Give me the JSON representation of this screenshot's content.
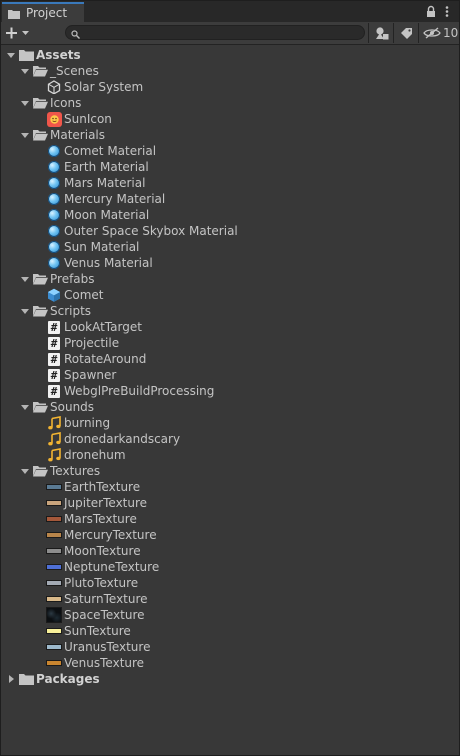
{
  "window": {
    "tab_title": "Project",
    "hidden_count": "10",
    "search": {
      "placeholder": "",
      "value": ""
    }
  },
  "icons": {
    "tab": "folder-tab-icon",
    "lock": "lock-icon",
    "menu": "kebab-menu-icon",
    "create": "plus-dropdown-icon",
    "search": "search-icon",
    "type_filter": "type-filter-icon",
    "label_filter": "label-tag-icon",
    "hidden": "eye-hidden-icon"
  },
  "tree": [
    {
      "label": "Assets",
      "depth": 0,
      "kind": "root",
      "expanded": true,
      "bold": true
    },
    {
      "label": "_Scenes",
      "depth": 1,
      "kind": "folder",
      "expanded": true
    },
    {
      "label": "Solar System",
      "depth": 2,
      "kind": "scene"
    },
    {
      "label": "Icons",
      "depth": 1,
      "kind": "folder",
      "expanded": true
    },
    {
      "label": "SunIcon",
      "depth": 2,
      "kind": "sunicon"
    },
    {
      "label": "Materials",
      "depth": 1,
      "kind": "folder",
      "expanded": true
    },
    {
      "label": "Comet Material",
      "depth": 2,
      "kind": "material"
    },
    {
      "label": "Earth Material",
      "depth": 2,
      "kind": "material"
    },
    {
      "label": "Mars Material",
      "depth": 2,
      "kind": "material"
    },
    {
      "label": "Mercury Material",
      "depth": 2,
      "kind": "material"
    },
    {
      "label": "Moon Material",
      "depth": 2,
      "kind": "material"
    },
    {
      "label": "Outer Space Skybox Material",
      "depth": 2,
      "kind": "material"
    },
    {
      "label": "Sun Material",
      "depth": 2,
      "kind": "material"
    },
    {
      "label": "Venus Material",
      "depth": 2,
      "kind": "material"
    },
    {
      "label": "Prefabs",
      "depth": 1,
      "kind": "folder",
      "expanded": true
    },
    {
      "label": "Comet",
      "depth": 2,
      "kind": "prefab"
    },
    {
      "label": "Scripts",
      "depth": 1,
      "kind": "folder",
      "expanded": true
    },
    {
      "label": "LookAtTarget",
      "depth": 2,
      "kind": "script"
    },
    {
      "label": "Projectile",
      "depth": 2,
      "kind": "script"
    },
    {
      "label": "RotateAround",
      "depth": 2,
      "kind": "script"
    },
    {
      "label": "Spawner",
      "depth": 2,
      "kind": "script"
    },
    {
      "label": "WebglPreBuildProcessing",
      "depth": 2,
      "kind": "script"
    },
    {
      "label": "Sounds",
      "depth": 1,
      "kind": "folder",
      "expanded": true
    },
    {
      "label": "burning",
      "depth": 2,
      "kind": "audio"
    },
    {
      "label": "dronedarkandscary",
      "depth": 2,
      "kind": "audio"
    },
    {
      "label": "dronehum",
      "depth": 2,
      "kind": "audio"
    },
    {
      "label": "Textures",
      "depth": 1,
      "kind": "folder",
      "expanded": true
    },
    {
      "label": "EarthTexture",
      "depth": 2,
      "kind": "texture",
      "color": "#5a7a93"
    },
    {
      "label": "JupiterTexture",
      "depth": 2,
      "kind": "texture",
      "color": "#c9a47c"
    },
    {
      "label": "MarsTexture",
      "depth": 2,
      "kind": "texture",
      "color": "#a4583a"
    },
    {
      "label": "MercuryTexture",
      "depth": 2,
      "kind": "texture",
      "color": "#b8854a"
    },
    {
      "label": "MoonTexture",
      "depth": 2,
      "kind": "texture",
      "color": "#8d8d8d"
    },
    {
      "label": "NeptuneTexture",
      "depth": 2,
      "kind": "texture",
      "color": "#4e6fd6"
    },
    {
      "label": "PlutoTexture",
      "depth": 2,
      "kind": "texture",
      "color": "#a3aab4"
    },
    {
      "label": "SaturnTexture",
      "depth": 2,
      "kind": "texture",
      "color": "#d9b98a"
    },
    {
      "label": "SpaceTexture",
      "depth": 2,
      "kind": "texture-space",
      "color": "#0c0f12"
    },
    {
      "label": "SunTexture",
      "depth": 2,
      "kind": "texture",
      "color": "#f8f09a"
    },
    {
      "label": "UranusTexture",
      "depth": 2,
      "kind": "texture",
      "color": "#9db9cc"
    },
    {
      "label": "VenusTexture",
      "depth": 2,
      "kind": "texture",
      "color": "#c9852f"
    },
    {
      "label": "Packages",
      "depth": 0,
      "kind": "root",
      "expanded": false,
      "bold": true
    }
  ]
}
